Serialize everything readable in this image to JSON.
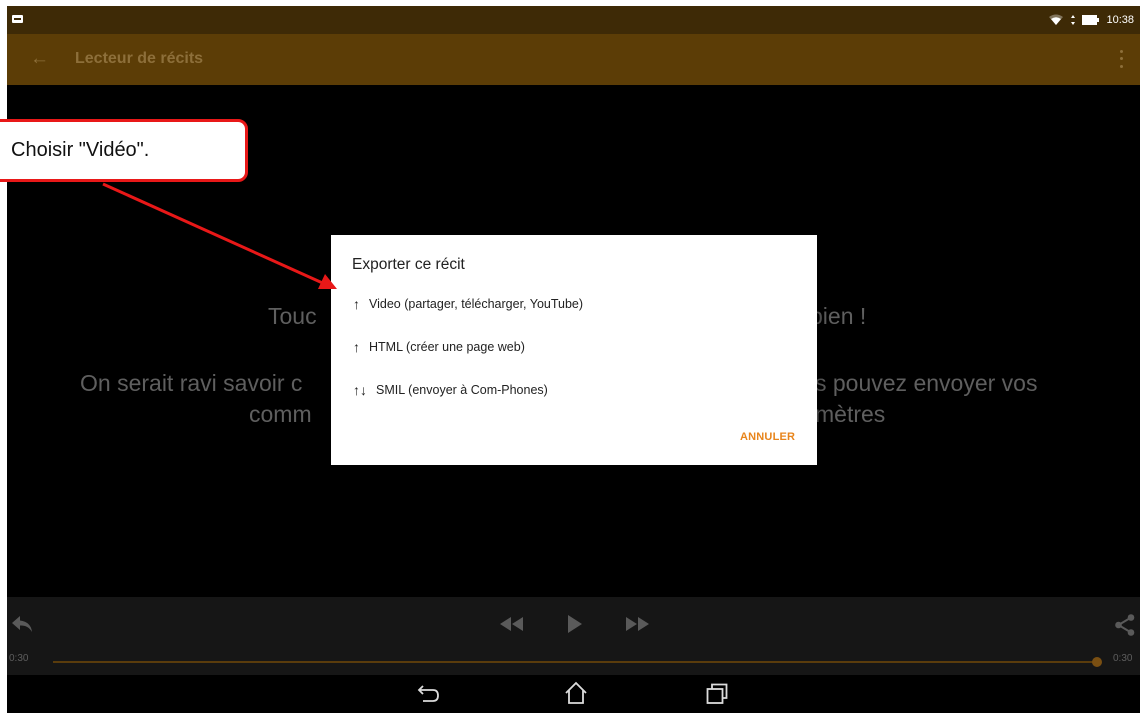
{
  "status_bar": {
    "time": "10:38"
  },
  "app_bar": {
    "title": "Lecteur de récits"
  },
  "background_text": {
    "line1_left": "Touc",
    "line1_right": "bien !",
    "line2_left": "On serait ravi savoir c",
    "line2_right": "s pouvez envoyer vos",
    "line3_left": "comm",
    "line3_right": "mètres"
  },
  "dialog": {
    "title": "Exporter ce récit",
    "options": [
      {
        "arrows": "↑",
        "label": "Video (partager, télécharger, YouTube)"
      },
      {
        "arrows": "↑",
        "label": "HTML (créer une page web)"
      },
      {
        "arrows": "↑↓",
        "label": "SMIL (envoyer à Com-Phones)"
      }
    ],
    "cancel_label": "ANNULER"
  },
  "player": {
    "time_start": "0:30",
    "time_end": "0:30",
    "progress": 1.0
  },
  "callout": {
    "text": "Choisir \"Vidéo\"."
  },
  "colors": {
    "accent": "#e8851c",
    "app_bar": "#5c3d06",
    "status_bar": "#3e2a06",
    "callout_border": "#e81818"
  }
}
